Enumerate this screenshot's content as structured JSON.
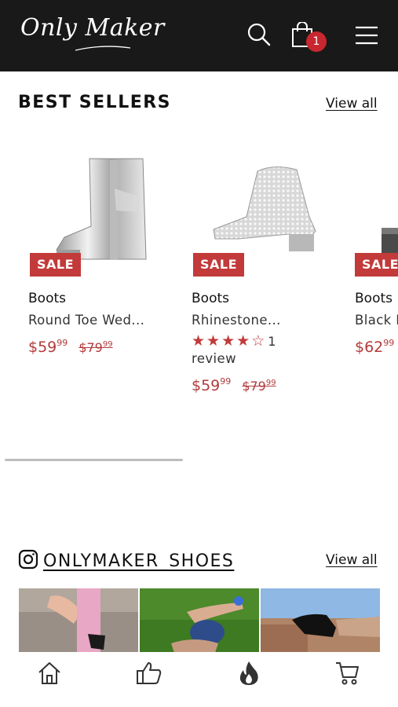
{
  "header": {
    "logo_text": "Only Maker",
    "cart_count": "1",
    "icons": [
      "search-icon",
      "shopping-bag-icon",
      "hamburger-menu-icon"
    ],
    "background": "#191919",
    "badge_color": "#c8272f"
  },
  "best_sellers": {
    "title": "BEST SELLERS",
    "view_all": "View all",
    "products": [
      {
        "sale": "SALE",
        "category": "Boots",
        "name": "Round Toe Wed...",
        "price_int": "$59",
        "price_cents": "99",
        "old_int": "$79",
        "old_cents": "99"
      },
      {
        "sale": "SALE",
        "category": "Boots",
        "name": "Rhinestone...",
        "rating": 4,
        "rating_count": "1",
        "rating_word": "review",
        "price_int": "$59",
        "price_cents": "99",
        "old_int": "$79",
        "old_cents": "99"
      },
      {
        "sale": "SALE",
        "category": "Boots",
        "name": "Black I",
        "price_int": "$62",
        "price_cents": "99"
      }
    ],
    "accent": "#c23a3a"
  },
  "instagram": {
    "handle": "ONLYMAKER_SHOES",
    "view_all": "View all",
    "icon": "instagram-icon"
  },
  "bottom_nav": {
    "icons": [
      "home-icon",
      "thumbs-up-icon",
      "fire-icon",
      "cart-icon"
    ]
  }
}
